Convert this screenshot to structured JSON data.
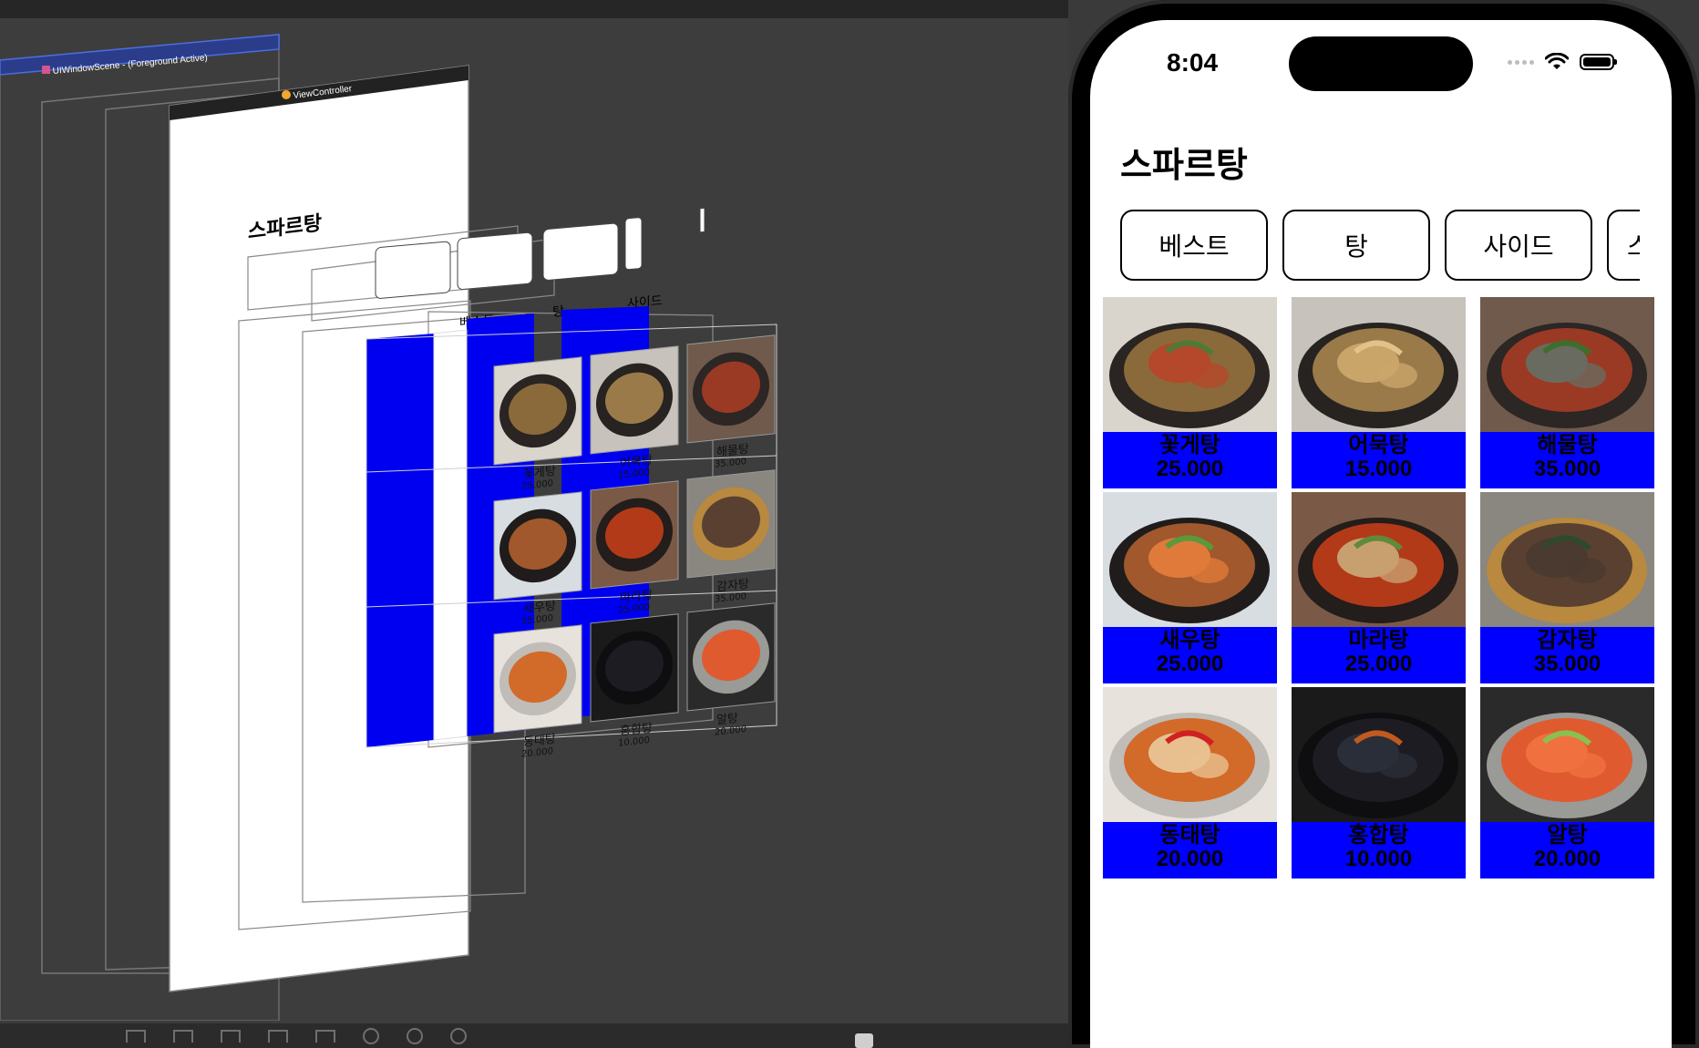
{
  "xcode": {
    "window_scene_label": "UIWindowScene - (Foreground Active)",
    "view_controller_label": "ViewController",
    "layer_title": "스파르탕",
    "layer_tabs": [
      "베스트",
      "탕",
      "사이드"
    ],
    "layer_items": [
      {
        "name": "꽃게탕",
        "price": "25.000"
      },
      {
        "name": "어묵탕",
        "price": "15.000"
      },
      {
        "name": "해물탕",
        "price": "35.000"
      },
      {
        "name": "새우탕",
        "price": "25.000"
      },
      {
        "name": "마라탕",
        "price": "25.000"
      },
      {
        "name": "감자탕",
        "price": "35.000"
      },
      {
        "name": "동태탕",
        "price": "20.000"
      },
      {
        "name": "홍합탕",
        "price": "10.000"
      },
      {
        "name": "알탕",
        "price": "20.000"
      }
    ]
  },
  "simulator": {
    "status_time": "8:04",
    "app_title": "스파르탕",
    "tabs": [
      {
        "label": "베스트"
      },
      {
        "label": "탕"
      },
      {
        "label": "사이드"
      },
      {
        "label": "스"
      }
    ],
    "menu": [
      {
        "name": "꽃게탕",
        "price": "25.000",
        "photo": "crab-stew"
      },
      {
        "name": "어묵탕",
        "price": "15.000",
        "photo": "fishcake-stew"
      },
      {
        "name": "해물탕",
        "price": "35.000",
        "photo": "seafood-stew"
      },
      {
        "name": "새우탕",
        "price": "25.000",
        "photo": "shrimp-stew"
      },
      {
        "name": "마라탕",
        "price": "25.000",
        "photo": "mala-stew"
      },
      {
        "name": "감자탕",
        "price": "35.000",
        "photo": "pork-bone-stew"
      },
      {
        "name": "동태탕",
        "price": "20.000",
        "photo": "pollock-stew"
      },
      {
        "name": "홍합탕",
        "price": "10.000",
        "photo": "mussel-stew"
      },
      {
        "name": "알탕",
        "price": "20.000",
        "photo": "roe-stew"
      }
    ],
    "cell_color": "#0000ff"
  }
}
